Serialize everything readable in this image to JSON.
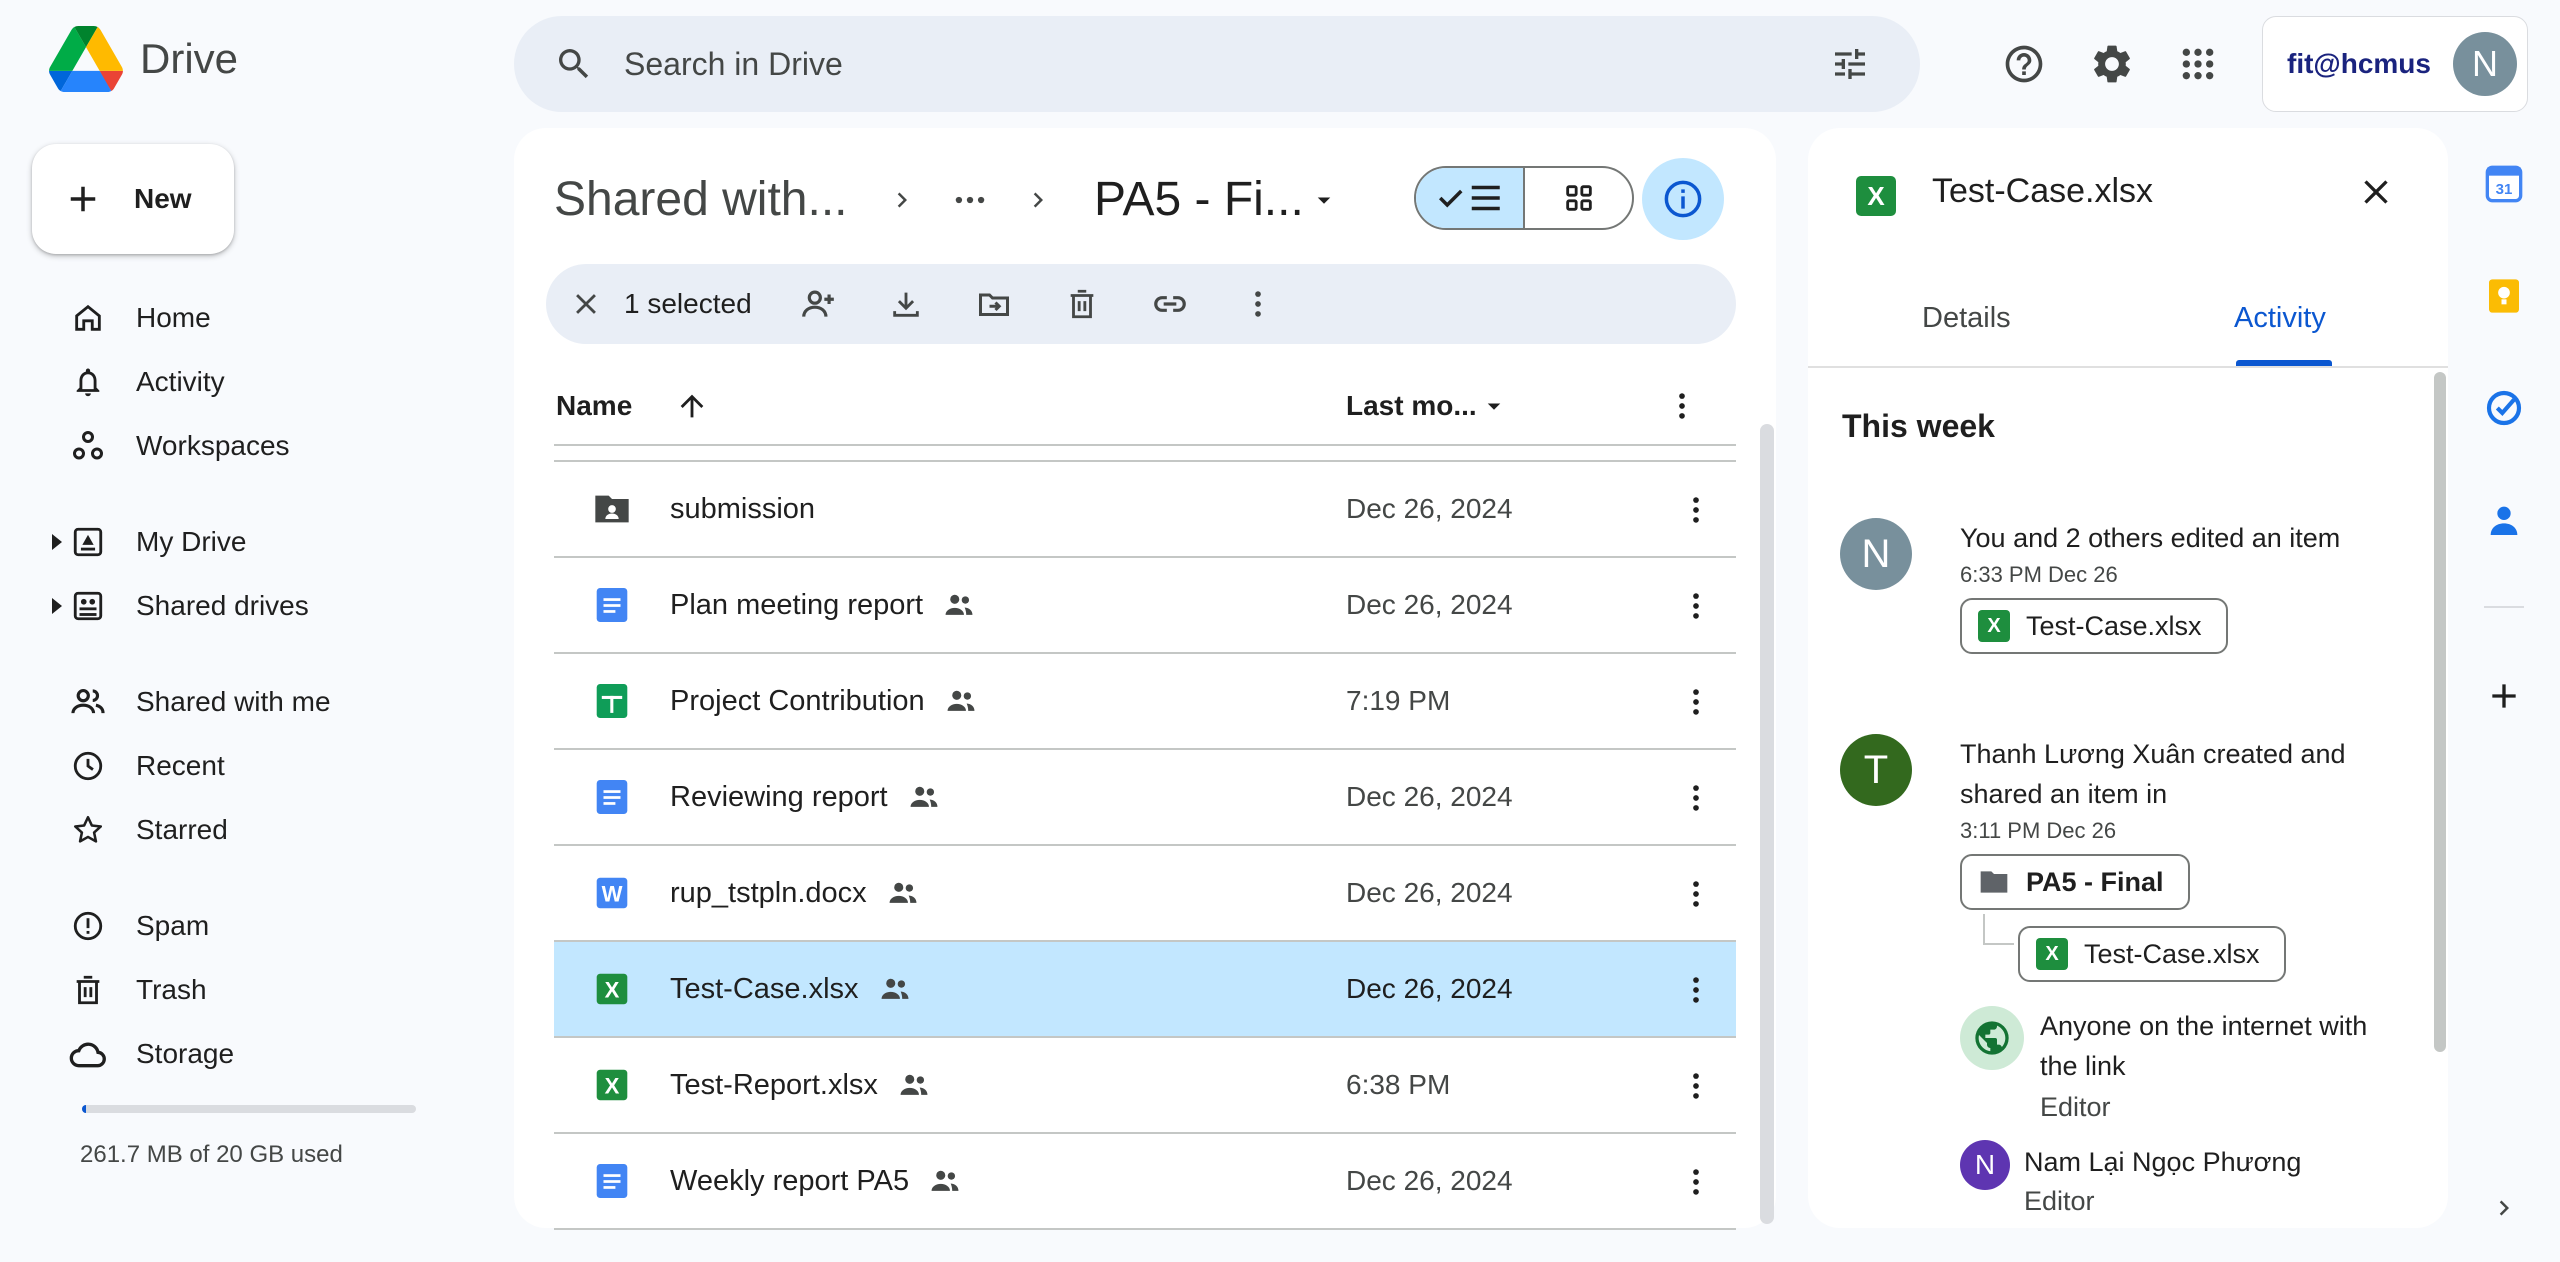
{
  "app": {
    "name": "Drive"
  },
  "search": {
    "placeholder": "Search in Drive"
  },
  "account": {
    "org": "fit@hcmus",
    "initial": "N"
  },
  "new_button": {
    "label": "New"
  },
  "nav": [
    {
      "label": "Home",
      "icon": "home-icon"
    },
    {
      "label": "Activity",
      "icon": "bell-icon"
    },
    {
      "label": "Workspaces",
      "icon": "workspaces-icon"
    },
    {
      "label": "My Drive",
      "icon": "my-drive-icon"
    },
    {
      "label": "Shared drives",
      "icon": "shared-drives-icon"
    },
    {
      "label": "Shared with me",
      "icon": "people-icon"
    },
    {
      "label": "Recent",
      "icon": "clock-icon"
    },
    {
      "label": "Starred",
      "icon": "star-icon"
    },
    {
      "label": "Spam",
      "icon": "spam-icon"
    },
    {
      "label": "Trash",
      "icon": "trash-icon"
    },
    {
      "label": "Storage",
      "icon": "cloud-icon"
    }
  ],
  "storage": {
    "text": "261.7 MB of 20 GB used",
    "used_fraction": 0.0128
  },
  "breadcrumb": {
    "root": "Shared with...",
    "current": "PA5 - Fi..."
  },
  "selection": {
    "text": "1 selected"
  },
  "columns": {
    "name": "Name",
    "modified": "Last mo..."
  },
  "files": [
    {
      "name": "submission",
      "type": "shared-folder",
      "shared": false,
      "modified": "Dec 26, 2024",
      "selected": false
    },
    {
      "name": "Plan meeting report",
      "type": "doc",
      "shared": true,
      "modified": "Dec 26, 2024",
      "selected": false
    },
    {
      "name": "Project Contribution",
      "type": "sheet",
      "shared": true,
      "modified": "7:19 PM",
      "selected": false
    },
    {
      "name": "Reviewing report",
      "type": "doc",
      "shared": true,
      "modified": "Dec 26, 2024",
      "selected": false
    },
    {
      "name": "rup_tstpln.docx",
      "type": "word",
      "shared": true,
      "modified": "Dec 26, 2024",
      "selected": false
    },
    {
      "name": "Test-Case.xlsx",
      "type": "excel",
      "shared": true,
      "modified": "Dec 26, 2024",
      "selected": true
    },
    {
      "name": "Test-Report.xlsx",
      "type": "excel",
      "shared": true,
      "modified": "6:38 PM",
      "selected": false
    },
    {
      "name": "Weekly report PA5",
      "type": "doc",
      "shared": true,
      "modified": "Dec 26, 2024",
      "selected": false
    }
  ],
  "details_panel": {
    "title": "Test-Case.xlsx",
    "tabs": {
      "details": "Details",
      "activity": "Activity"
    },
    "section": "This week",
    "activities": [
      {
        "initial": "N",
        "text": "You and 2 others edited an item",
        "time": "6:33 PM Dec 26",
        "chip": "Test-Case.xlsx"
      },
      {
        "initial": "T",
        "text_line1": "Thanh Lương Xuân created and",
        "text_line2": "shared an item in",
        "time": "3:11 PM Dec 26",
        "folder_chip": "PA5 - Final",
        "file_chip": "Test-Case.xlsx"
      }
    ],
    "permissions": [
      {
        "name_line1": "Anyone on the internet with",
        "name_line2": "the link",
        "role": "Editor"
      },
      {
        "initial": "N",
        "name": "Nam Lại Ngọc Phương",
        "role": "Editor"
      }
    ]
  },
  "colors": {
    "accent": "#0b57d0",
    "selected_row": "#c2e7ff",
    "excel": "#1e8e3e",
    "docs": "#4285f4"
  }
}
